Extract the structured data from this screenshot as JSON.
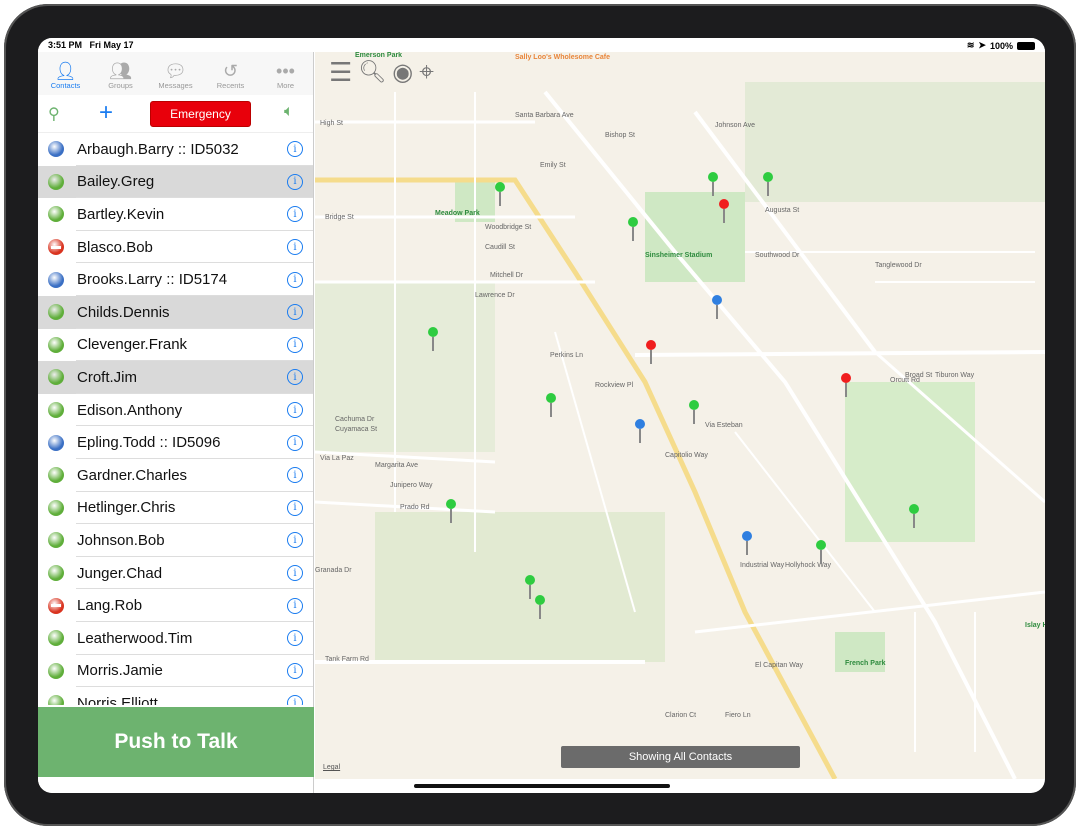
{
  "status_bar": {
    "time": "3:51 PM",
    "date": "Fri May 17",
    "battery": "100%"
  },
  "tabs": [
    {
      "label": "Contacts",
      "icon": "person-icon",
      "active": true
    },
    {
      "label": "Groups",
      "icon": "group-icon"
    },
    {
      "label": "Messages",
      "icon": "chat-bubbles-icon"
    },
    {
      "label": "Recents",
      "icon": "history-icon"
    },
    {
      "label": "More",
      "icon": "more-icon"
    }
  ],
  "toolbar": {
    "emergency_label": "Emergency"
  },
  "colors": {
    "accent": "#1a7cf0",
    "emergency": "#e8000b",
    "ptt": "#6db36f",
    "online": "#5fae3a",
    "idle": "#3a6fc4",
    "blocked": "#d9331f"
  },
  "contacts": [
    {
      "name": "Arbaugh.Barry :: ID5032",
      "status": "idle"
    },
    {
      "name": "Bailey.Greg",
      "status": "online",
      "selected": true
    },
    {
      "name": "Bartley.Kevin",
      "status": "online"
    },
    {
      "name": "Blasco.Bob",
      "status": "blocked"
    },
    {
      "name": "Brooks.Larry :: ID5174",
      "status": "idle"
    },
    {
      "name": "Childs.Dennis",
      "status": "online",
      "selected": true
    },
    {
      "name": "Clevenger.Frank",
      "status": "online"
    },
    {
      "name": "Croft.Jim",
      "status": "online",
      "selected": true
    },
    {
      "name": "Edison.Anthony",
      "status": "online"
    },
    {
      "name": "Epling.Todd :: ID5096",
      "status": "idle"
    },
    {
      "name": "Gardner.Charles",
      "status": "online"
    },
    {
      "name": "Hetlinger.Chris",
      "status": "online"
    },
    {
      "name": "Johnson.Bob",
      "status": "online"
    },
    {
      "name": "Junger.Chad",
      "status": "online"
    },
    {
      "name": "Lang.Rob",
      "status": "blocked"
    },
    {
      "name": "Leatherwood.Tim",
      "status": "online"
    },
    {
      "name": "Morris.Jamie",
      "status": "online"
    },
    {
      "name": "Norris.Elliott",
      "status": "online"
    }
  ],
  "push_to_talk": "Push to Talk",
  "map": {
    "status": "Showing All Contacts",
    "legal": "Legal",
    "labels": [
      "Emerson Park",
      "Sally Loo's Wholesome Cafe",
      "High St",
      "Meadow Park",
      "Bridge St",
      "Woodbridge St",
      "Caudill St",
      "Mitchell Dr",
      "Lawrence Dr",
      "Sinsheimer Stadium",
      "Johnson Ave",
      "Augusta St",
      "Southwood Dr",
      "Tanglewood Dr",
      "Orcutt Rd",
      "Tiburon Way",
      "Perkins Ln",
      "Rockview Pl",
      "Via Esteban",
      "Capitolio Way",
      "Margarita Ave",
      "Via La Paz",
      "Junipero Way",
      "Prado Rd",
      "Industrial Way",
      "Tank Farm Rd",
      "El Capitan Way",
      "French Park",
      "Clarion Ct",
      "Fiero Ln",
      "Granada Dr",
      "Broad St",
      "Cachuma Dr",
      "Cuyamaca St",
      "Islay Hill",
      "Santa Barbara Ave",
      "Emily St",
      "Bishop St",
      "Hollyhock Way"
    ],
    "pins": [
      "green",
      "green",
      "red",
      "green",
      "green",
      "blue",
      "red",
      "red",
      "green",
      "green",
      "blue",
      "green",
      "blue",
      "green",
      "green",
      "green",
      "green",
      "green"
    ]
  }
}
